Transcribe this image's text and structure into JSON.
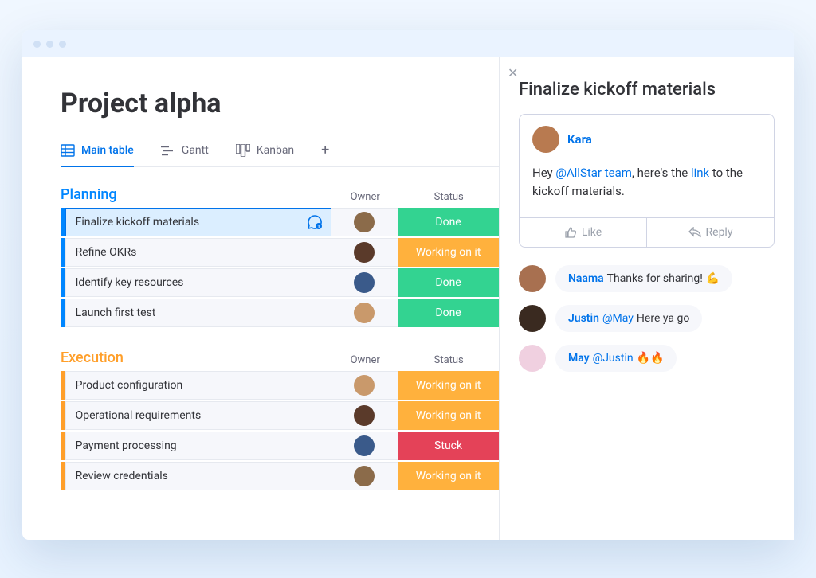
{
  "page": {
    "title": "Project alpha"
  },
  "tabs": [
    {
      "label": "Main table",
      "icon": "table-icon",
      "active": true
    },
    {
      "label": "Gantt",
      "icon": "gantt-icon",
      "active": false
    },
    {
      "label": "Kanban",
      "icon": "kanban-icon",
      "active": false
    }
  ],
  "columns": {
    "owner": "Owner",
    "status": "Status"
  },
  "groups": [
    {
      "name": "Planning",
      "color": "blue",
      "rows": [
        {
          "name": "Finalize kickoff materials",
          "owner_color": "#8b6b4a",
          "status": "Done",
          "status_key": "done",
          "selected": true,
          "has_chat": true
        },
        {
          "name": "Refine OKRs",
          "owner_color": "#5a3a2a",
          "status": "Working on it",
          "status_key": "working"
        },
        {
          "name": "Identify key resources",
          "owner_color": "#3a5a8a",
          "status": "Done",
          "status_key": "done"
        },
        {
          "name": "Launch first test",
          "owner_color": "#c9996b",
          "status": "Done",
          "status_key": "done"
        }
      ]
    },
    {
      "name": "Execution",
      "color": "orange",
      "rows": [
        {
          "name": "Product configuration",
          "owner_color": "#c9996b",
          "status": "Working on it",
          "status_key": "working"
        },
        {
          "name": "Operational requirements",
          "owner_color": "#5a3a2a",
          "status": "Working on it",
          "status_key": "working"
        },
        {
          "name": "Payment processing",
          "owner_color": "#3a5a8a",
          "status": "Stuck",
          "status_key": "stuck"
        },
        {
          "name": "Review credentials",
          "owner_color": "#8b6b4a",
          "status": "Working on it",
          "status_key": "working"
        }
      ]
    }
  ],
  "side": {
    "title": "Finalize kickoff materials",
    "comment": {
      "author": "Kara",
      "author_color": "#b87a50",
      "text_pre": "Hey ",
      "mention": "@AllStar team",
      "text_mid": ", here's the ",
      "link": "link",
      "text_post": " to the kickoff materials."
    },
    "actions": {
      "like": "Like",
      "reply": "Reply"
    },
    "replies": [
      {
        "author": "Naama",
        "author_color": "#a87050",
        "text": "Thanks for sharing!",
        "emoji": "💪"
      },
      {
        "author": "Justin",
        "author_color": "#3a2a20",
        "mention": "@May",
        "text": "Here ya go"
      },
      {
        "author": "May",
        "author_color": "#f0d0e0",
        "mention": "@Justin",
        "emoji": "🔥🔥"
      }
    ]
  }
}
